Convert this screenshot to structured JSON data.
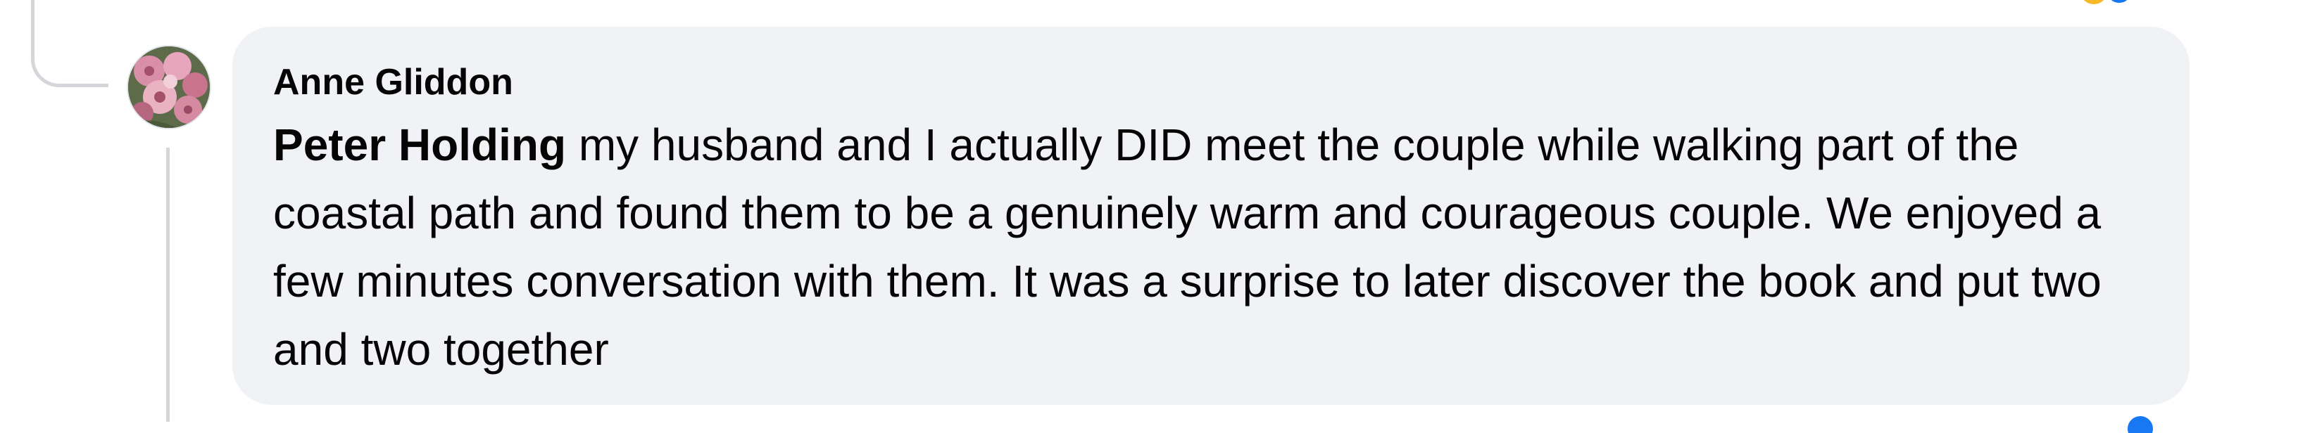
{
  "comment": {
    "author": "Anne Gliddon",
    "mention": "Peter Holding",
    "text": " my husband and I actually DID meet the couple while walking part of the coastal path and found them to be a genuinely warm and courageous couple. We enjoyed a few minutes conversation with them. It was a surprise to later discover the book and put two and two together"
  },
  "colors": {
    "bubble": "#f0f2f5",
    "text": "#050505",
    "thread_line": "#d4d6da",
    "like_blue": "#1877f2",
    "reaction_orange": "#f7b928"
  },
  "icons": {
    "avatar": "profile-photo-pink-flowers",
    "reactions": "like-reaction-icon"
  }
}
